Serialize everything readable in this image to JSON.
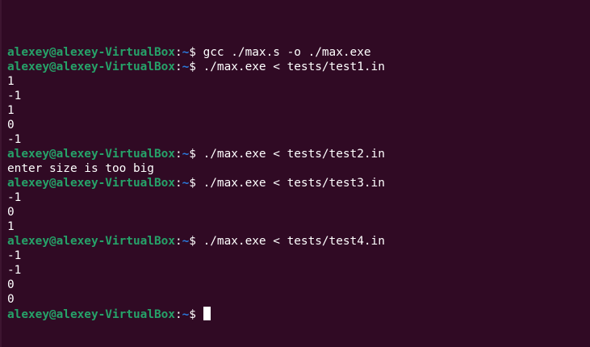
{
  "prompt": {
    "user_host": "alexey@alexey-VirtualBox",
    "sep": ":",
    "path": "~",
    "sign": "$ "
  },
  "lines": [
    {
      "type": "prompt",
      "command": "gcc ./max.s -o ./max.exe"
    },
    {
      "type": "prompt",
      "command": "./max.exe < tests/test1.in"
    },
    {
      "type": "output",
      "text": "1"
    },
    {
      "type": "output",
      "text": "-1"
    },
    {
      "type": "output",
      "text": "1"
    },
    {
      "type": "output",
      "text": "0"
    },
    {
      "type": "output",
      "text": "-1"
    },
    {
      "type": "prompt",
      "command": "./max.exe < tests/test2.in"
    },
    {
      "type": "output",
      "text": "enter size is too big"
    },
    {
      "type": "prompt",
      "command": "./max.exe < tests/test3.in"
    },
    {
      "type": "output",
      "text": "-1"
    },
    {
      "type": "output",
      "text": "0"
    },
    {
      "type": "output",
      "text": "1"
    },
    {
      "type": "prompt",
      "command": "./max.exe < tests/test4.in"
    },
    {
      "type": "output",
      "text": "-1"
    },
    {
      "type": "output",
      "text": "-1"
    },
    {
      "type": "output",
      "text": "0"
    },
    {
      "type": "output",
      "text": "0"
    },
    {
      "type": "prompt",
      "command": "",
      "cursor": true
    }
  ],
  "colors": {
    "background": "#300a24",
    "user_host": "#26a269",
    "path": "#2a7bde",
    "text": "#ffffff"
  }
}
